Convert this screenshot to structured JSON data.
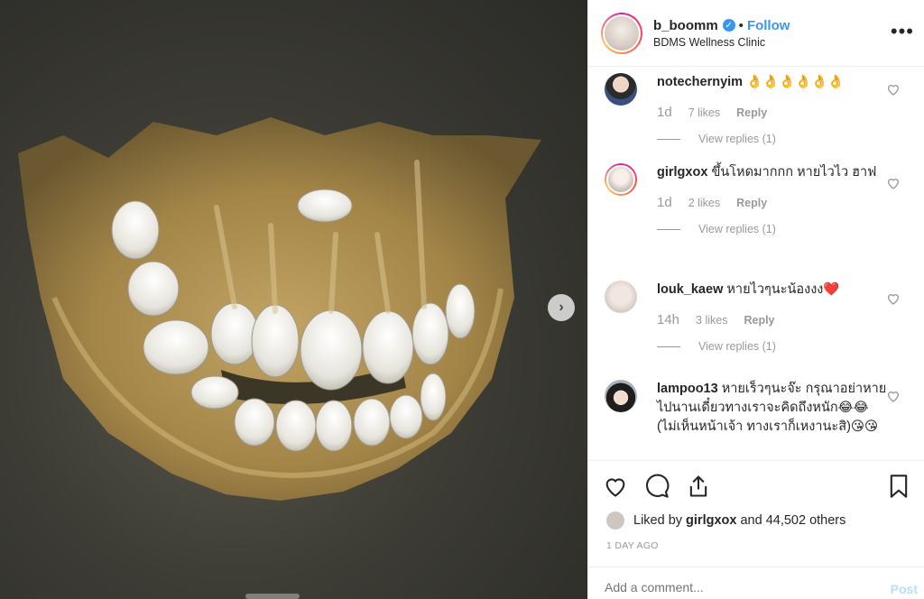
{
  "post": {
    "username": "b_boomm",
    "verified_icon": "verified-badge-icon",
    "separator": "•",
    "follow_label": "Follow",
    "location": "BDMS Wellness Clinic",
    "more_label": "•••",
    "next_label": "›"
  },
  "comments": [
    {
      "user": "notechernyim",
      "text": "👌👌👌👌👌👌",
      "time": "1d",
      "likes": "7 likes",
      "reply": "Reply",
      "view_replies": "View replies (1)"
    },
    {
      "user": "girlgxox",
      "text": "ขึ้นโหดมากกก หายไวไว ฮาฟ",
      "time": "1d",
      "likes": "2 likes",
      "reply": "Reply",
      "view_replies": "View replies (1)"
    },
    {
      "user": "louk_kaew",
      "text": "หายไวๆนะน้องงง❤️",
      "time": "14h",
      "likes": "3 likes",
      "reply": "Reply",
      "view_replies": "View replies (1)"
    },
    {
      "user": "lampoo13",
      "text": "หายเร็วๆนะจ๊ะ กรุณาอย่าหายไปนานเดี๋ยวทางเราจะคิดถึงหนัก😂😂(ไม่เห็นหน้าเจ้า ทางเราก็เหงานะสิ)😘😘"
    }
  ],
  "likes": {
    "prefix": "Liked by",
    "user": "girlgxox",
    "suffix": "and 44,502 others"
  },
  "posted_ago": "1 DAY AGO",
  "comment_box": {
    "placeholder": "Add a comment...",
    "post_label": "Post"
  },
  "colors": {
    "accent": "#3897f0",
    "heart": "#ed4956",
    "muted": "#999999"
  }
}
